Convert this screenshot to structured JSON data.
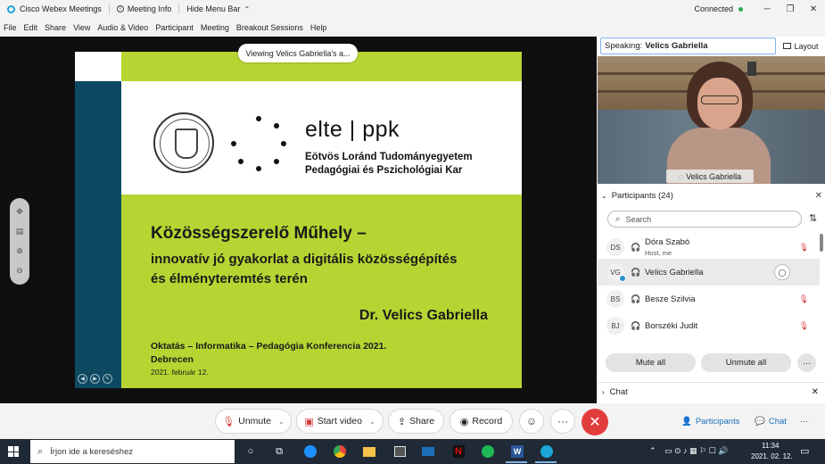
{
  "titlebar": {
    "app_name": "Cisco Webex Meetings",
    "meeting_info": "Meeting Info",
    "hide_menu": "Hide Menu Bar",
    "hide_menu_chev": "⌃",
    "status": "Connected",
    "minimize": "─",
    "restore": "❐",
    "close": "✕"
  },
  "menu": [
    "File",
    "Edit",
    "Share",
    "View",
    "Audio & Video",
    "Participant",
    "Meeting",
    "Breakout Sessions",
    "Help"
  ],
  "stage": {
    "viewing_label": "Viewing Velics Gabriella's a..."
  },
  "slide": {
    "brand": "elte | ppk",
    "university_line1": "Eötvös Loránd Tudományegyetem",
    "university_line2": "Pedagógiai és Pszichológiai Kar",
    "title": "Közösségszerelő Műhely –",
    "subtitle1": "innovatív jó gyakorlat a digitális közösségépítés",
    "subtitle2": "és élményteremtés terén",
    "author": "Dr. Velics Gabriella",
    "conference": "Oktatás – Informatika – Pedagógia Konferencia 2021.",
    "city": "Debrecen",
    "date": "2021. február 12."
  },
  "controls": {
    "unmute": "Unmute",
    "start_video": "Start video",
    "share": "Share",
    "record": "Record",
    "reactions_icon": "☺",
    "more": "···",
    "end": "✕",
    "participants_tab": "Participants",
    "chat_tab": "Chat",
    "more_right": "···"
  },
  "right_panel": {
    "speaking_label": "Speaking:",
    "speaking_name": "Velics Gabriella",
    "layout": "Layout",
    "video_name": "Velics Gabriella",
    "participants_header": "Participants (24)",
    "search_placeholder": "Search",
    "participants": [
      {
        "initials": "DS",
        "name": "Dóra Szabó",
        "role": "Host, me",
        "muted": true,
        "selected": false
      },
      {
        "initials": "VG",
        "name": "Velics Gabriella",
        "role": "",
        "muted": false,
        "selected": true
      },
      {
        "initials": "BS",
        "name": "Besze Szilvia",
        "role": "",
        "muted": true,
        "selected": false
      },
      {
        "initials": "BJ",
        "name": "Borszéki Judit",
        "role": "",
        "muted": true,
        "selected": false
      }
    ],
    "mute_all": "Mute all",
    "unmute_all": "Unmute all",
    "chat_header": "Chat"
  },
  "taskbar": {
    "search_placeholder": "Írjon ide a kereséshez",
    "time": "11:34",
    "date": "2021. 02. 12."
  },
  "colors": {
    "slide_green": "#b6d532",
    "slide_blue": "#0d4a61",
    "end_red": "#e23d3d",
    "accent_blue": "#1b6fb8",
    "taskbar": "#1f2a36"
  }
}
